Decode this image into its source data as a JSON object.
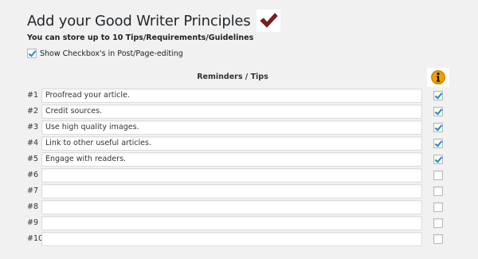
{
  "title": "Add your Good Writer Principles",
  "subtitle": "You can store up to 10 Tips/Requirements/Guidelines",
  "show_checkbox": {
    "label": "Show Checkbox's in Post/Page-editing",
    "checked": true
  },
  "table": {
    "header": "Reminders / Tips",
    "info_icon": "info-icon",
    "rows": [
      {
        "num": "#1",
        "text": "Proofread your article.",
        "checked": true
      },
      {
        "num": "#2",
        "text": "Credit sources.",
        "checked": true
      },
      {
        "num": "#3",
        "text": "Use high quality images.",
        "checked": true
      },
      {
        "num": "#4",
        "text": "Link to other useful articles.",
        "checked": true
      },
      {
        "num": "#5",
        "text": "Engage with readers.",
        "checked": true
      },
      {
        "num": "#6",
        "text": "",
        "checked": false
      },
      {
        "num": "#7",
        "text": "",
        "checked": false
      },
      {
        "num": "#8",
        "text": "",
        "checked": false
      },
      {
        "num": "#9",
        "text": "",
        "checked": false
      },
      {
        "num": "#10",
        "text": "",
        "checked": false
      }
    ]
  },
  "colors": {
    "checkmark_red": "#8b1a1a",
    "info_orange": "#f0a000",
    "checkbox_blue": "#1e8cbe",
    "background": "#f1f1f1"
  }
}
